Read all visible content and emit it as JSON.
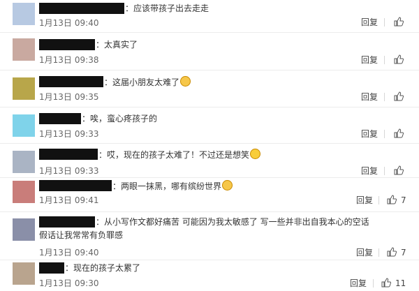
{
  "comments": [
    {
      "text": "：应该带孩子出去走走",
      "date": "1月13日",
      "time": "09:40",
      "reply": "回复",
      "likes": "",
      "avatar_color": "#b7c9e2"
    },
    {
      "text": "：太真实了",
      "date": "1月13日",
      "time": "09:38",
      "reply": "回复",
      "likes": "",
      "avatar_color": "#c9a9a0"
    },
    {
      "text": "：这届小朋友太难了",
      "date": "1月13日",
      "time": "09:35",
      "reply": "回复",
      "likes": "",
      "avatar_color": "#b8a64a",
      "emoji": "crying-face-icon"
    },
    {
      "text": "：唉，蛮心疼孩子的",
      "date": "1月13日",
      "time": "09:33",
      "reply": "回复",
      "likes": "",
      "avatar_color": "#7fd3ea"
    },
    {
      "text": "：哎，现在的孩子太难了！不过还是想笑",
      "date": "1月13日",
      "time": "09:33",
      "reply": "回复",
      "likes": "",
      "avatar_color": "#aab4c4",
      "emoji": "laughing-face-icon"
    },
    {
      "text": "：两眼一抹黑，哪有缤纷世界",
      "date": "1月13日",
      "time": "09:41",
      "reply": "回复",
      "likes": "7",
      "avatar_color": "#c97d7a",
      "emoji": "crying-face-icon"
    },
    {
      "text": "：从小写作文都好痛苦 可能因为我太敏感了 写一些并非出自我本心的空话",
      "text2": "假话让我常常有负罪感",
      "date": "1月13日",
      "time": "09:40",
      "reply": "回复",
      "likes": "7",
      "avatar_color": "#8a8fa8"
    },
    {
      "text": "：现在的孩子太累了",
      "date": "1月13日",
      "time": "09:30",
      "reply": "回复",
      "likes": "11",
      "avatar_color": "#b9a48e"
    }
  ]
}
